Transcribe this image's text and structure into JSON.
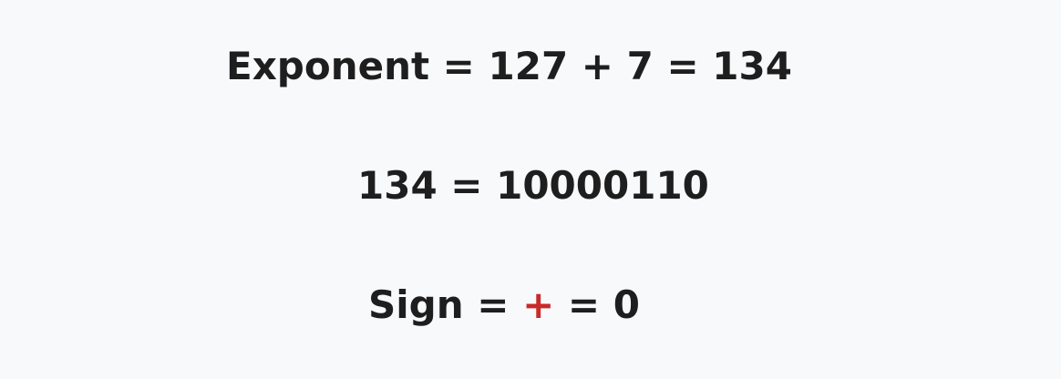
{
  "lines": {
    "exponent": "Exponent = 127 + 7 = 134",
    "binary": "134 = 10000110",
    "sign": {
      "label": "Sign =",
      "symbol": "+",
      "result": "= 0"
    }
  },
  "colors": {
    "background": "#f8f9fb",
    "text": "#1e1e1e",
    "sign_symbol": "#c92a2a"
  }
}
